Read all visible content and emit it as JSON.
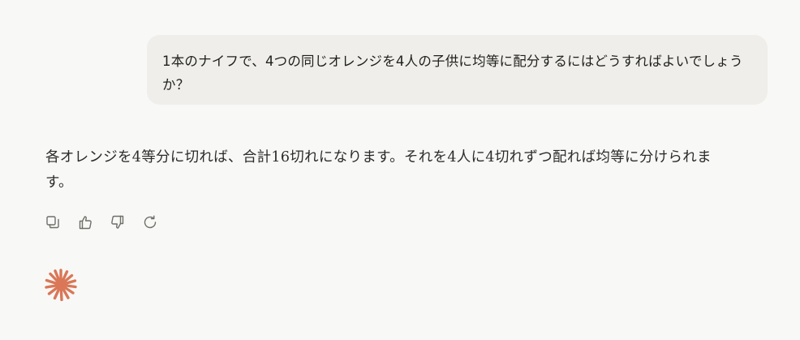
{
  "conversation": {
    "user_message": "1本のナイフで、4つの同じオレンジを4人の子供に均等に配分するにはどうすればよいでしょうか？",
    "assistant_message": "各オレンジを4等分に切れば、合計16切れになります。それを4人に4切れずつ配れば均等に分けられます。"
  },
  "actions": [
    {
      "icon": "copy-icon"
    },
    {
      "icon": "thumbs-up-icon"
    },
    {
      "icon": "thumbs-down-icon"
    },
    {
      "icon": "retry-icon"
    }
  ],
  "colors": {
    "background": "#f8f8f6",
    "user_bubble": "#efeeea",
    "icon": "#6f6e69",
    "logo": "#d97757"
  },
  "logo": {
    "icon": "starburst-logo-icon"
  }
}
